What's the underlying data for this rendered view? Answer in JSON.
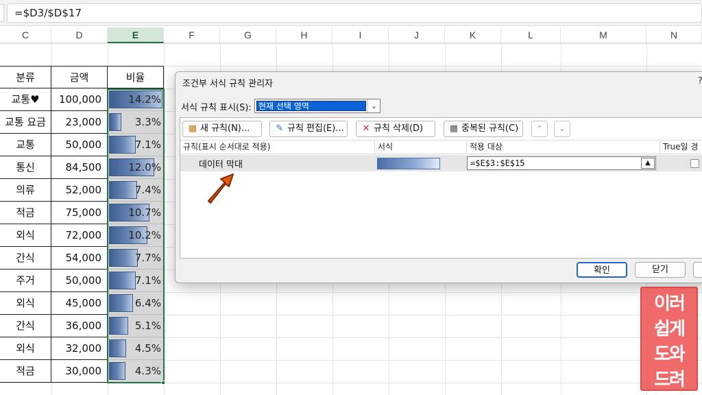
{
  "formula_bar": {
    "formula": "=$D3/$D$17"
  },
  "columns": [
    "C",
    "D",
    "E",
    "F",
    "G",
    "H",
    "I",
    "J",
    "K",
    "L",
    "M",
    "N"
  ],
  "selected_column": "E",
  "table": {
    "headers": [
      "분류",
      "금액",
      "비율"
    ],
    "rows": [
      {
        "category": "교통♥",
        "amount": "100,000",
        "ratio": "14.2%",
        "fill": 0.142
      },
      {
        "category": "교통 요금",
        "amount": "23,000",
        "ratio": "3.3%",
        "fill": 0.033
      },
      {
        "category": "교통",
        "amount": "50,000",
        "ratio": "7.1%",
        "fill": 0.071
      },
      {
        "category": "통신",
        "amount": "84,500",
        "ratio": "12.0%",
        "fill": 0.12
      },
      {
        "category": "의류",
        "amount": "52,000",
        "ratio": "7.4%",
        "fill": 0.074
      },
      {
        "category": "적금",
        "amount": "75,000",
        "ratio": "10.7%",
        "fill": 0.107
      },
      {
        "category": "외식",
        "amount": "72,000",
        "ratio": "10.2%",
        "fill": 0.102
      },
      {
        "category": "간식",
        "amount": "54,000",
        "ratio": "7.7%",
        "fill": 0.077
      },
      {
        "category": "주거",
        "amount": "50,000",
        "ratio": "7.1%",
        "fill": 0.071
      },
      {
        "category": "외식",
        "amount": "45,000",
        "ratio": "6.4%",
        "fill": 0.064
      },
      {
        "category": "간식",
        "amount": "36,000",
        "ratio": "5.1%",
        "fill": 0.051
      },
      {
        "category": "외식",
        "amount": "32,000",
        "ratio": "4.5%",
        "fill": 0.045
      },
      {
        "category": "적금",
        "amount": "30,000",
        "ratio": "4.3%",
        "fill": 0.043
      }
    ]
  },
  "dialog": {
    "title": "조건부 서식 규칙 관리자",
    "help": "?",
    "show_rules_label": "서식 규칙 표시(S):",
    "show_rules_value": "현재 선택 영역",
    "toolbar": {
      "new_rule": "새 규칙(N)...",
      "edit_rule": "규칙 편집(E)...",
      "delete_rule": "규칙 삭제(D)",
      "duplicate_rule": "중복된 규칙(C)"
    },
    "columns": {
      "rule": "규칙(표시 순서대로 적용)",
      "format": "서식",
      "applies_to": "적용 대상",
      "stop_if_true": "True일 경우"
    },
    "rule": {
      "name": "데이터 막대",
      "applies_to": "=$E$3:$E$15"
    },
    "ok": "확인",
    "close": "닫기"
  },
  "colors": {
    "accent_green": "#217346",
    "bar_blue": "#3e5e92",
    "annotation": "#e8560c",
    "stamp": "#ef5a5a"
  },
  "stamp_text": [
    "이러",
    "쉽게",
    "도와",
    "드려"
  ]
}
